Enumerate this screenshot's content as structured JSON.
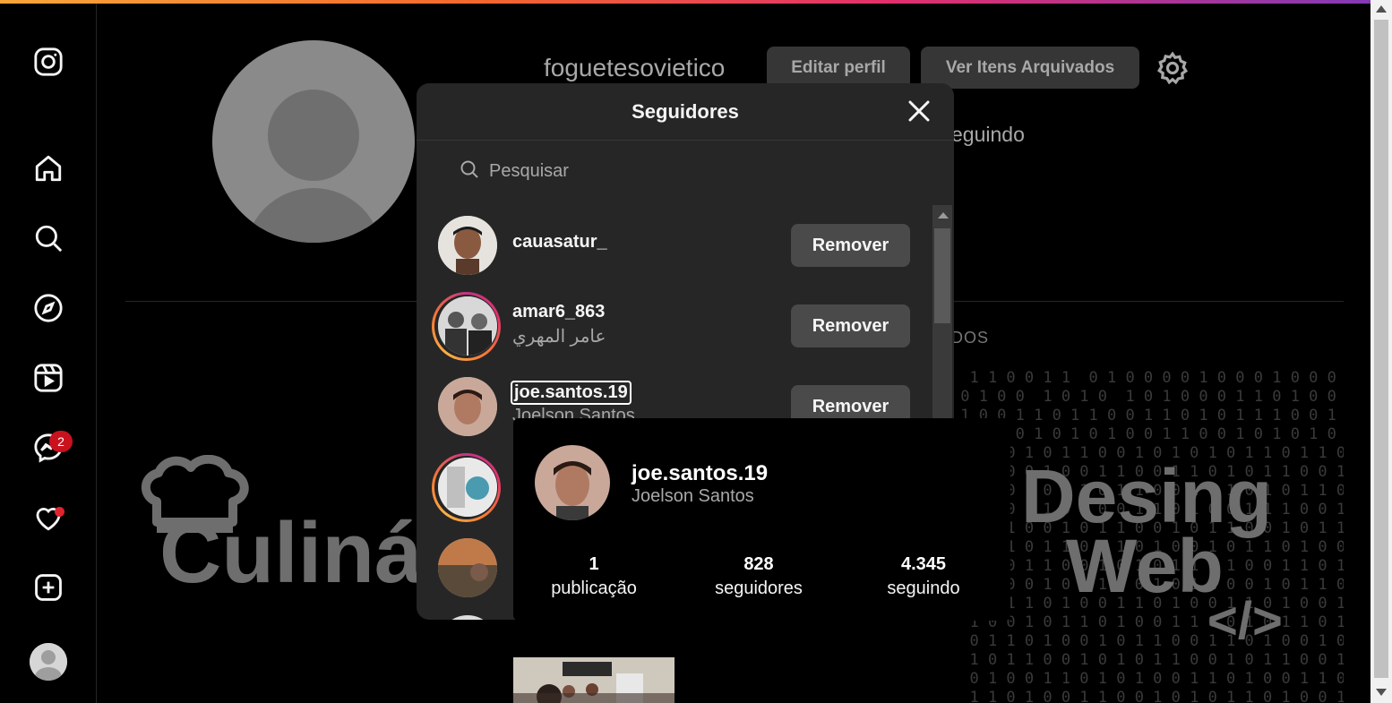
{
  "profile": {
    "username": "foguetesovietico",
    "edit_button": "Editar perfil",
    "archive_button": "Ver Itens Arquivados",
    "following_partial": "eguindo",
    "tab_partial": "DOS"
  },
  "sidebar": {
    "messages_badge": "2"
  },
  "background": {
    "desing": "Desing",
    "web": "Web",
    "code": "</>",
    "culinaria": "Culinár",
    "matrix_lines": [
      "  1 1 0 0 1 1  0 1 0 0 0 0 1 0 0 0 1 0 0 0 1 0",
      " 0 1 0 0  1 0 1 0  1 0 1 0 0 0 1 1 0 1 0 0 1 0",
      " 1 0 0 1 1 0 1 1 0 0 1 1 0 1 0 1 1 1 0 0 1 0 0",
      " 1 1 0 0 1 0 1 0 1 0 0 1 1 0 0 1 0 1 0 1 0 1 0",
      "  1 0 0 1 0 1 1 0 0 1 0 1 0 1 0 1 1 0 1 1 0 1",
      "  1 1 0 0 1 0 0 1 1 0 0 1 1 0 1 0 1 1 0 0 1 0",
      "  0 1 0 1 0 1 1 0 1 1 0 0 1 0 1 0 1 0 1 1 0 1",
      "  1 0 0 1 1 0 1 0 0 1 1 0 1 0 0 1 1 1 0 0 1 1",
      "  0 1 1 0 0 1 0 1 1 0 0 1 0 1 1 0 0 1 0 1 1 0",
      "  1 0 1 0 1 1 0 0 1 0 1 0 0 1 0 1 1 0 1 0 0 1",
      "  0 1 0 1 1 0 0 1 0 1 0 1 1 0 1 0 0 1 1 0 1 0",
      "  1 1 0 0 1 0 1 1 0 0 1 0 1 1 0 0 1 0 1 1 0 0",
      "  0 0 1 1 0 1 0 0 1 1 0 1 0 0 1 1 0 1 0 0 1 1",
      "  1 0 0 1 0 1 1 0 1 0 0 1 1 0 0 1 0 1 1 0 1 0",
      "  0 1 1 0 1 0 0 1 0 1 1 0 0 1 1 0 1 0 0 1 0 1",
      "  1 0 1 1 0 0 1 0 1 0 1 1 0 0 1 0 1 1 0 0 1 0",
      "  0 1 0 0 1 1 0 1 0 1 0 0 1 1 0 1 0 0 1 1 0 1",
      "  1 1 0 1 0 0 1 1 0 0 1 0 1 0 1 1 0 1 0 0 1 1"
    ]
  },
  "modal": {
    "title": "Seguidores",
    "search_placeholder": "Pesquisar",
    "remove_label": "Remover",
    "followers": [
      {
        "username": "cauasatur_",
        "fullname": ""
      },
      {
        "username": "amar6_863",
        "fullname": "عامر المهري"
      },
      {
        "username": "joe.santos.19",
        "fullname": "Joelson Santos"
      }
    ]
  },
  "hovercard": {
    "username": "joe.santos.19",
    "fullname": "Joelson Santos",
    "stats": [
      {
        "value": "1",
        "label": "publicação"
      },
      {
        "value": "828",
        "label": "seguidores"
      },
      {
        "value": "4.345",
        "label": "seguindo"
      }
    ]
  }
}
